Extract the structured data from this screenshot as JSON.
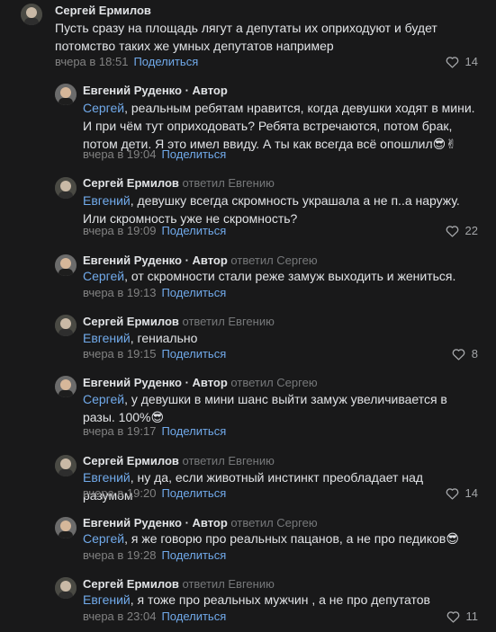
{
  "comments": [
    {
      "author": "Сергей Ермилов",
      "author_suffix": "",
      "reply_to": "",
      "mention": "",
      "text": "Пусть сразу на площадь лягут а депутаты их оприходуют и будет потомство таких же умных депутатов например",
      "emoji": "",
      "time": "вчера в 18:51",
      "share": "Поделиться",
      "likes": "14",
      "avatar": "avatar-ermilov"
    },
    {
      "author": "Евгений Руденко",
      "author_suffix": " · Автор",
      "reply_to": "",
      "mention": "Сергей",
      "text": ", реальным ребятам нравится, когда девушки ходят в мини. И при чём тут оприходовать? Ребята встречаются, потом брак, потом дети. Я это имел ввиду. А ты как всегда всё опошлил",
      "emoji": "😎✌",
      "time": "вчера в 19:04",
      "share": "Поделиться",
      "likes": "",
      "avatar": "avatar-rudenko"
    },
    {
      "author": "Сергей Ермилов",
      "author_suffix": "",
      "reply_to": "ответил Евгению",
      "mention": "Евгений",
      "text": ", девушку всегда скромность украшала а не п..а наружу. Или скромность уже не скромность?",
      "emoji": "",
      "time": "вчера в 19:09",
      "share": "Поделиться",
      "likes": "22",
      "avatar": "avatar-ermilov"
    },
    {
      "author": "Евгений Руденко",
      "author_suffix": " · Автор",
      "reply_to": "ответил Сергею",
      "mention": "Сергей",
      "text": ", от скромности стали реже замуж выходить и жениться.",
      "emoji": "",
      "time": "вчера в 19:13",
      "share": "Поделиться",
      "likes": "",
      "avatar": "avatar-rudenko"
    },
    {
      "author": "Сергей Ермилов",
      "author_suffix": "",
      "reply_to": "ответил Евгению",
      "mention": "Евгений",
      "text": ", гениально",
      "emoji": "",
      "time": "вчера в 19:15",
      "share": "Поделиться",
      "likes": "8",
      "avatar": "avatar-ermilov"
    },
    {
      "author": "Евгений Руденко",
      "author_suffix": " · Автор",
      "reply_to": "ответил Сергею",
      "mention": "Сергей",
      "text": ", у девушки в мини шанс выйти замуж увеличивается в разы. 100%",
      "emoji": "😎",
      "time": "вчера в 19:17",
      "share": "Поделиться",
      "likes": "",
      "avatar": "avatar-rudenko"
    },
    {
      "author": "Сергей Ермилов",
      "author_suffix": "",
      "reply_to": "ответил Евгению",
      "mention": "Евгений",
      "text": ", ну да, если животный инстинкт преобладает над разумом",
      "emoji": "",
      "time": "вчера в 19:20",
      "share": "Поделиться",
      "likes": "14",
      "avatar": "avatar-ermilov"
    },
    {
      "author": "Евгений Руденко",
      "author_suffix": " · Автор",
      "reply_to": "ответил Сергею",
      "mention": "Сергей",
      "text": ", я же говорю про реальных пацанов, а не про педиков",
      "emoji": "😎",
      "time": "вчера в 19:28",
      "share": "Поделиться",
      "likes": "",
      "avatar": "avatar-rudenko"
    },
    {
      "author": "Сергей Ермилов",
      "author_suffix": "",
      "reply_to": "ответил Евгению",
      "mention": "Евгений",
      "text": ", я тоже про реальных мужчин , а не про депутатов",
      "emoji": "",
      "time": "вчера в 23:04",
      "share": "Поделиться",
      "likes": "11",
      "avatar": "avatar-ermilov"
    }
  ],
  "colors": {
    "background": "#19191a",
    "link": "#71aaeb",
    "muted": "#828282",
    "text": "#e1e3e6"
  },
  "icons": {
    "like": "heart-icon"
  }
}
